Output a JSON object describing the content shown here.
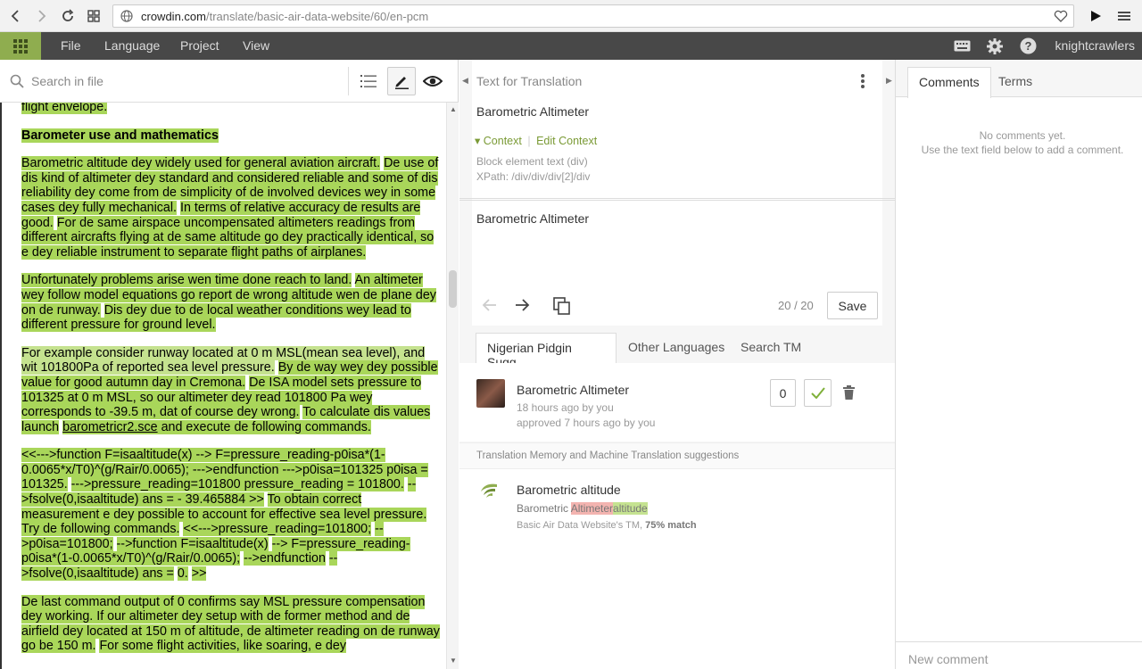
{
  "browser": {
    "url_domain": "crowdin.com",
    "url_path": "/translate/basic-air-data-website/60/en-pcm"
  },
  "menu": {
    "file": "File",
    "language": "Language",
    "project": "Project",
    "view": "View",
    "user": "knightcrawlers"
  },
  "left": {
    "search_placeholder": "Search in file"
  },
  "doc": {
    "p0": "flight envelope.",
    "h": "Barometer use and mathematics",
    "p1a": "Barometric altitude dey widely used for general aviation aircraft.",
    "p1b": "De use of dis kind of altimeter dey standard and considered reliable and some of dis reliability dey come from de simplicity of de involved devices wey in some cases dey fully mechanical.",
    "p1c": "In terms of relative accuracy de results are good.",
    "p1d": "For de same airspace uncompensated altimeters readings from different aircrafts flying at de same altitude go dey practically identical, so e dey reliable instrument to separate flight paths of airplanes.",
    "p2a": "Unfortunately problems arise wen time done reach to land.",
    "p2b": "An altimeter wey follow model equations go report de wrong altitude wen de plane dey on de runway.",
    "p2c": "Dis dey due to de local weather conditions wey lead to different pressure for ground level.",
    "p3a": "For example consider runway located at 0 m MSL(mean sea level), and wit 101800Pa of reported sea level pressure.",
    "p3b": "By de way wey dey possible value for good autumn day in Cremona.",
    "p3c": "De ISA model sets pressure to 101325 at 0 m MSL, so our altimeter dey read 101800 Pa wey corresponds to -39.5 m, dat of course dey wrong.",
    "p3d": "To calculate dis values launch",
    "p3e": "barometricr2.sce",
    "p3f": "and execute de following commands.",
    "p4a": "<<--->function F=isaaltitude(x) --> F=pressure_reading-p0isa*(1-0.0065*x/T0)^(g/Rair/0.0065); --->endfunction --->p0isa=101325 p0isa = 101325.",
    "p4b": "--->pressure_reading=101800 pressure_reading = 101800.",
    "p4c": "-->fsolve(0,isaaltitude) ans = - 39.465884 >>",
    "p4d": "To obtain correct measurement e dey possible to account for effective sea level pressure.",
    "p4e": "Try de following commands.",
    "p4f": "<<--->pressure_reading=101800;",
    "p4g": "-->p0isa=101800;",
    "p4h": "-->function F=isaaltitude(x)",
    "p4i": "--> F=pressure_reading-p0isa*(1-0.0065*x/T0)^(g/Rair/0.0065);",
    "p4j": "-->endfunction",
    "p4k": "-->fsolve(0,isaaltitude) ans =",
    "p4l": "0.",
    "p4m": ">>",
    "p5a": "De last command output of 0 confirms say MSL pressure compensation dey working. If our altimeter dey setup with de former method and de airfield dey located at 150 m of altitude, de altimeter reading on de runway go be 150 m.",
    "p5b": "For some flight activities, like soaring, e dey"
  },
  "mid": {
    "header": "Text for Translation",
    "source": "Barometric Altimeter",
    "context": "Context",
    "edit_context": "Edit Context",
    "info1": "Block element text (div)",
    "info2": "XPath: /div/div/div[2]/div",
    "translation": "Barometric Altimeter",
    "counter": "20 / 20",
    "save": "Save"
  },
  "sugg": {
    "tab1": "Nigerian Pidgin Sugg...",
    "tab2": "Other Languages",
    "tab3": "Search TM",
    "title": "Barometric Altimeter",
    "meta1": "18 hours ago by you",
    "meta2": "approved 7 hours ago by you",
    "votes": "0",
    "tm_header": "Translation Memory and Machine Translation suggestions",
    "tm_title": "Barometric altitude",
    "diff_base": "Barometric ",
    "diff_del": "Altimeter",
    "diff_ins": "altitude",
    "tm_source": "Basic Air Data Website's TM, ",
    "tm_match": "75% match"
  },
  "right": {
    "tab1": "Comments",
    "tab2": "Terms",
    "empty1": "No comments yet.",
    "empty2": "Use the text field below to add a comment.",
    "new_comment": "New comment"
  },
  "colors": {
    "accent": "#8fad4f",
    "highlight": "#a9d65a",
    "appbar": "#484848"
  }
}
